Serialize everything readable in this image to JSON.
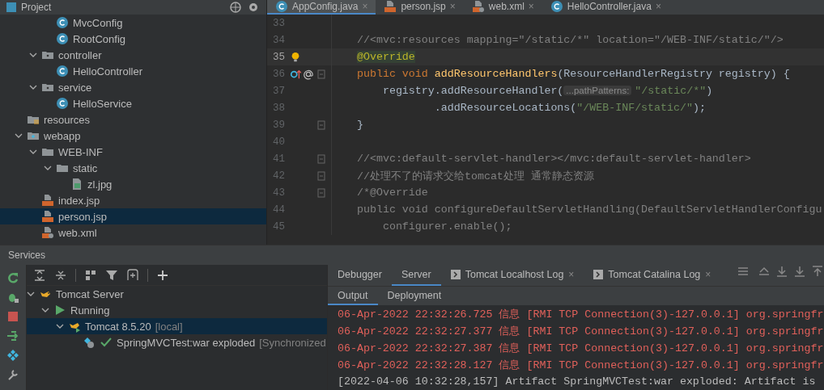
{
  "project": {
    "title": "Project",
    "tree": [
      {
        "children": [
          {
            "children": [
              {
                "label": "MvcConfig",
                "kind": "class"
              },
              {
                "label": "RootConfig",
                "kind": "class"
              }
            ]
          },
          {
            "label": "controller",
            "kind": "package",
            "expanded": true,
            "children": [
              {
                "label": "HelloController",
                "kind": "class"
              }
            ]
          },
          {
            "label": "service",
            "kind": "package",
            "expanded": true,
            "children": [
              {
                "label": "HelloService",
                "kind": "class"
              }
            ]
          }
        ]
      },
      {
        "label": "resources",
        "kind": "resources"
      },
      {
        "label": "webapp",
        "kind": "webfolder",
        "expanded": true,
        "children": [
          {
            "label": "WEB-INF",
            "kind": "folder",
            "expanded": true,
            "children": [
              {
                "label": "static",
                "kind": "folder",
                "expanded": true,
                "children": [
                  {
                    "label": "zl.jpg",
                    "kind": "image"
                  }
                ]
              }
            ]
          },
          {
            "label": "index.jsp",
            "kind": "jsp",
            "selected": false
          },
          {
            "label": "person.jsp",
            "kind": "jsp",
            "selected": true
          },
          {
            "label": "web.xml",
            "kind": "xml",
            "selected": false
          }
        ]
      }
    ]
  },
  "editor": {
    "tabs": [
      {
        "label": "AppConfig.java",
        "kind": "class",
        "selected": true,
        "close": "×"
      },
      {
        "label": "person.jsp",
        "kind": "jsp",
        "selected": false,
        "close": "×"
      },
      {
        "label": "web.xml",
        "kind": "xml",
        "selected": false,
        "close": "×"
      },
      {
        "label": "HelloController.java",
        "kind": "class",
        "selected": false,
        "close": "×"
      }
    ],
    "lines": [
      {
        "number": "33",
        "current": false
      },
      {
        "number": "34",
        "current": false,
        "tokens": [
          {
            "kind": "comment",
            "s": "//<mvc:resources mapping=\"/static/*\" location=\"/WEB-INF/static/\"/>"
          }
        ]
      },
      {
        "number": "35",
        "current": true,
        "markers": [
          {
            "kind": "bulb"
          }
        ],
        "tokens": [
          {
            "kind": "annotation",
            "s": "@Override"
          }
        ]
      },
      {
        "number": "36",
        "current": false,
        "markers": [
          {
            "kind": "override"
          }
        ],
        "fold": true,
        "tokens": [
          {
            "kind": "keyword",
            "s": "public void "
          },
          {
            "kind": "method",
            "s": "addResourceHandlers"
          },
          {
            "kind": "plain",
            "s": "(ResourceHandlerRegistry registry) {"
          }
        ]
      },
      {
        "number": "37",
        "current": false,
        "tokens": [
          {
            "kind": "plain",
            "s": "    registry.addResourceHandler("
          },
          {
            "kind": "hint",
            "s": "...pathPatterns:"
          },
          {
            "kind": "string",
            "s": "\"/static/*\""
          },
          {
            "kind": "plain",
            "s": ")"
          }
        ]
      },
      {
        "number": "38",
        "current": false,
        "tokens": [
          {
            "kind": "plain",
            "s": "            .addResourceLocations("
          },
          {
            "kind": "string",
            "s": "\"/WEB-INF/static/\""
          },
          {
            "kind": "plain",
            "s": ");"
          }
        ]
      },
      {
        "number": "39",
        "current": false,
        "fold": true,
        "tokens": [
          {
            "kind": "plain",
            "s": "}"
          }
        ]
      },
      {
        "number": "40",
        "current": false
      },
      {
        "number": "41",
        "current": false,
        "fold": true,
        "tokens": [
          {
            "kind": "comment",
            "s": "//<mvc:default-servlet-handler></mvc:default-servlet-handler>"
          }
        ]
      },
      {
        "number": "42",
        "current": false,
        "fold": true,
        "tokens": [
          {
            "kind": "comment",
            "s": "//处理不了的请求交给tomcat处理 通常静态资源"
          }
        ]
      },
      {
        "number": "43",
        "current": false,
        "fold": true,
        "tokens": [
          {
            "kind": "comment",
            "s": "/*@Override"
          }
        ]
      },
      {
        "number": "44",
        "current": false,
        "tokens": [
          {
            "kind": "comment",
            "s": "public void configureDefaultServletHandling(DefaultServletHandlerConfigu"
          }
        ]
      },
      {
        "number": "45",
        "current": false,
        "tokens": [
          {
            "kind": "comment",
            "s": "    configurer.enable();"
          }
        ]
      }
    ]
  },
  "services": {
    "title": "Services",
    "tree": [
      {
        "label": "Tomcat Server",
        "kind": "tomcat",
        "expanded": true,
        "selected": false,
        "children": [
          {
            "label": "Running",
            "kind": "running",
            "expanded": true,
            "selected": false,
            "children": [
              {
                "label": "Tomcat 8.5.20",
                "note": "[local]",
                "kind": "tomcat-run",
                "expanded": true,
                "selected": true,
                "children": [
                  {
                    "label": "SpringMVCTest:war exploded",
                    "note": "[Synchronized",
                    "kind": "artifact",
                    "selected": false
                  }
                ]
              }
            ]
          }
        ]
      }
    ],
    "tabs": [
      {
        "label": "Debugger",
        "selected": false
      },
      {
        "label": "Server",
        "selected": true
      },
      {
        "label": "Tomcat Localhost Log",
        "selected": false,
        "close": "×"
      },
      {
        "label": "Tomcat Catalina Log",
        "selected": false,
        "close": "×"
      }
    ],
    "subtabs": [
      {
        "label": "Output",
        "selected": true
      },
      {
        "label": "Deployment",
        "selected": false
      }
    ],
    "log": [
      {
        "kind": "error",
        "text": "06-Apr-2022 22:32:26.725 信息 [RMI TCP Connection(3)-127.0.0.1] org.springfr"
      },
      {
        "kind": "error",
        "text": "06-Apr-2022 22:32:27.377 信息 [RMI TCP Connection(3)-127.0.0.1] org.springfr"
      },
      {
        "kind": "error",
        "text": "06-Apr-2022 22:32:27.387 信息 [RMI TCP Connection(3)-127.0.0.1] org.springfr"
      },
      {
        "kind": "error",
        "text": "06-Apr-2022 22:32:28.127 信息 [RMI TCP Connection(3)-127.0.0.1] org.springfr"
      },
      {
        "kind": "info",
        "text": "[2022-04-06 10:32:28,157] Artifact SpringMVCTest:war exploded: Artifact is"
      }
    ]
  }
}
